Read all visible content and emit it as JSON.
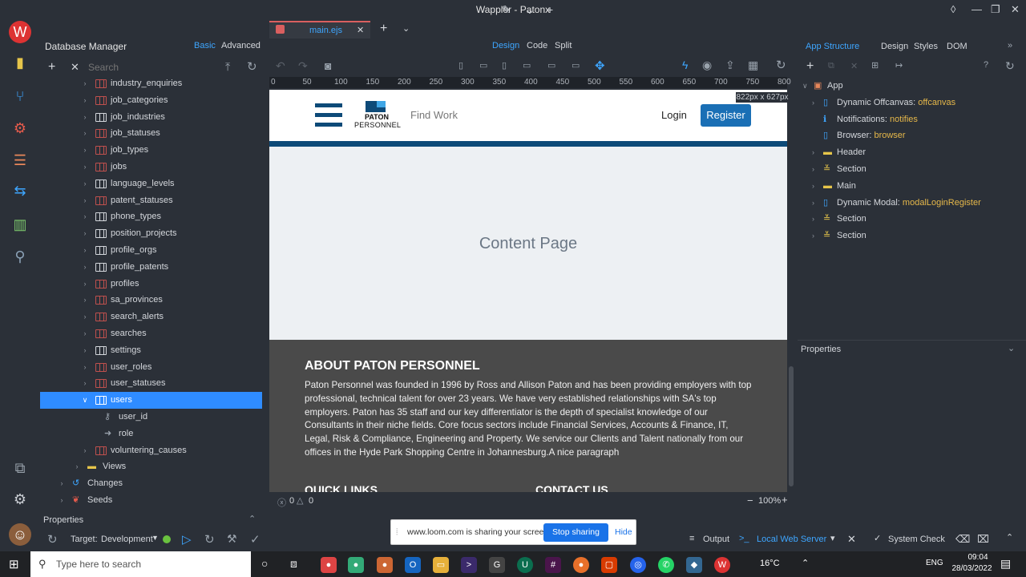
{
  "window": {
    "title": "Wappler - Patonx"
  },
  "left_panel": {
    "title": "Database Manager",
    "mode_basic": "Basic",
    "mode_advanced": "Advanced",
    "search_placeholder": "Search",
    "tables": [
      "industry_enquiries",
      "job_categories",
      "job_industries",
      "job_statuses",
      "job_types",
      "jobs",
      "language_levels",
      "patent_statuses",
      "phone_types",
      "position_projects",
      "profile_orgs",
      "profile_patents",
      "profiles",
      "sa_provinces",
      "search_alerts",
      "searches",
      "settings",
      "user_roles",
      "user_statuses",
      "users"
    ],
    "users_fields": [
      "user_id",
      "role"
    ],
    "after_tables": [
      "voluntering_causes"
    ],
    "views": "Views",
    "changes": "Changes",
    "seeds": "Seeds",
    "properties": "Properties",
    "target_label": "Target:",
    "target_value": "Development"
  },
  "editor": {
    "tab": "main.ejs",
    "mode_design": "Design",
    "mode_code": "Code",
    "mode_split": "Split",
    "ruler_ticks": [
      "0",
      "50",
      "100",
      "150",
      "200",
      "250",
      "300",
      "350",
      "400",
      "450",
      "500",
      "550",
      "600",
      "650",
      "700",
      "750",
      "800"
    ],
    "size_badge": "822px x 627px",
    "zoom": "100%",
    "errors": "0",
    "warnings": "0"
  },
  "page": {
    "brand_top": "PATON",
    "brand_bottom": "PERSONNEL",
    "find_work": "Find Work",
    "login": "Login",
    "register": "Register",
    "content_title": "Content Page",
    "about_title": "ABOUT PATON PERSONNEL",
    "about_text": "Paton Personnel was founded in 1996 by Ross and Allison Paton and has been providing employers with top professional, technical talent for over 23 years. We have very established relationships with SA's top employers. Paton has 35 staff and our key differentiator is the depth of specialist knowledge of our Consultants in their niche fields. Core focus sectors include Financial Services, Accounts & Finance, IT, Legal, Risk & Compliance, Engineering and Property. We service our Clients and Talent nationally from our offices in the Hyde Park Shopping Centre in Johannesburg.A nice paragraph",
    "quick_links": "QUICK LINKS",
    "contact_us": "CONTACT US"
  },
  "right_panel": {
    "tab_app_structure": "App Structure",
    "tab_design": "Design",
    "tab_styles": "Styles",
    "tab_dom": "DOM",
    "tree": [
      {
        "label": "App",
        "value": ""
      },
      {
        "label": "Dynamic Offcanvas: ",
        "value": "offcanvas"
      },
      {
        "label": "Notifications: ",
        "value": "notifies"
      },
      {
        "label": "Browser: ",
        "value": "browser"
      },
      {
        "label": "Header",
        "value": ""
      },
      {
        "label": "Section",
        "value": ""
      },
      {
        "label": "Main",
        "value": ""
      },
      {
        "label": "Dynamic Modal: ",
        "value": "modalLoginRegister"
      },
      {
        "label": "Section",
        "value": ""
      },
      {
        "label": "Section",
        "value": ""
      }
    ],
    "properties": "Properties"
  },
  "bottom": {
    "share_text": "www.loom.com is sharing your screen.",
    "stop_sharing": "Stop sharing",
    "hide": "Hide",
    "output": "Output",
    "local_web_server": "Local Web Server",
    "system_check": "System Check"
  },
  "taskbar": {
    "search_placeholder": "Type here to search",
    "temp": "16°C",
    "lang": "ENG",
    "time": "09:04",
    "date": "28/03/2022"
  },
  "colors": {
    "accent": "#2f8cff",
    "brand": "#1a6fb5",
    "navy": "#0d4a78",
    "table_red": "#c0504d",
    "footer": "#4a4a4a"
  }
}
